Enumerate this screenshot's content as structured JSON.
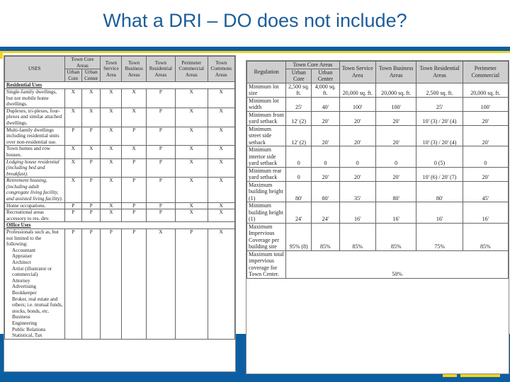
{
  "title": "What a DRI – DO does not include?",
  "uses_table": {
    "headers": {
      "uses": "USES",
      "town_core": "Town Core Areas",
      "urban_core": "Urban Core",
      "urban_center": "Urban Center",
      "town_service": "Town Service Area",
      "town_business": "Town Business Areas",
      "town_residential": "Town Residential Areas",
      "perimeter_commercial": "Perimeter Commercial Areas",
      "town_commons": "Town Commons Areas"
    },
    "section_residential": "Residential Uses",
    "residential_rows": [
      {
        "use": "Single-family dwellings, but not mobile home dwellings.",
        "v": [
          "X",
          "X",
          "X",
          "X",
          "P",
          "X",
          "X"
        ]
      },
      {
        "use": "Duplexes, tri-plexes, four-plexes and similar attached dwellings.",
        "v": [
          "X",
          "X",
          "X",
          "X",
          "P",
          "X",
          "X"
        ]
      },
      {
        "use": "Multi-family dwellings including residential units over non-residential use.",
        "v": [
          "P",
          "P",
          "X",
          "P",
          "P",
          "X",
          "X"
        ]
      },
      {
        "use": "Town homes and row houses.",
        "v": [
          "X",
          "X",
          "X",
          "X",
          "P",
          "X",
          "X"
        ]
      },
      {
        "use": "Lodging house residential (including bed and breakfast).",
        "v": [
          "X",
          "P",
          "X",
          "P",
          "P",
          "X",
          "X"
        ]
      },
      {
        "use": "Retirement housing, (including adult congregate living facility, and assisted living facility).",
        "v": [
          "X",
          "P",
          "X",
          "P",
          "P",
          "X",
          "X"
        ]
      },
      {
        "use": "Home occupations.",
        "v": [
          "P",
          "P",
          "X",
          "P",
          "P",
          "X",
          "X"
        ]
      },
      {
        "use": "Recreational areas accessory to res. dev.",
        "v": [
          "P",
          "P",
          "X",
          "P",
          "P",
          "X",
          "X"
        ]
      }
    ],
    "section_office": "Office Uses",
    "office_rows": [
      {
        "use": "Professionals such as, but not limited to the following:",
        "items": [
          "Accountant",
          "Appraiser",
          "Architect",
          "Artist (illustrator or commercial)",
          "Attorney",
          "Advertising",
          "Bookkeeper",
          "Broker, real estate and others; i.e. mutual funds, stocks, bonds, etc.",
          "Business",
          "Engineering",
          "Public Relations",
          "Statistical, Tax"
        ],
        "v": [
          "P",
          "P",
          "P",
          "P",
          "X",
          "P",
          "X"
        ]
      }
    ]
  },
  "regulation_table": {
    "headers": {
      "regulation": "Regulation",
      "town_core": "Town Core Areas",
      "urban_core": "Urban Core",
      "urban_center": "Urban Center",
      "town_service": "Town Service Area",
      "town_business": "Town Business Areas",
      "town_residential": "Town Residential Areas",
      "perimeter_commercial": "Perimeter Commercial"
    },
    "rows": [
      {
        "label": "Minimum lot size",
        "v": [
          "2,500 sq. ft.",
          "4,000 sq. ft.",
          "20,000 sq. ft.",
          "20,000 sq. ft.",
          "2,500 sq. ft.",
          "20,000 sq. ft."
        ]
      },
      {
        "label": "Minimum lot width",
        "v": [
          "25'",
          "40'",
          "100'",
          "100'",
          "25'",
          "100'"
        ]
      },
      {
        "label": "Minimum front yard setback",
        "v": [
          "12' (2)",
          "20'",
          "20'",
          "20'",
          "10' (3) / 20' (4)",
          "20'"
        ]
      },
      {
        "label": "Minimum street side setback",
        "v": [
          "12' (2)",
          "20'",
          "20'",
          "20'",
          "10' (3) / 20' (4)",
          "20'"
        ]
      },
      {
        "label": "Minimum interior side yard setback",
        "v": [
          "0",
          "0",
          "0",
          "0",
          "0 (5)",
          "0"
        ]
      },
      {
        "label": "Minimum rear yard setback",
        "v": [
          "0",
          "20'",
          "20'",
          "20'",
          "10' (6) / 20' (7)",
          "20'"
        ]
      },
      {
        "label": "Maximum building height (1)",
        "v": [
          "80'",
          "80'",
          "35'",
          "80'",
          "80'",
          "45'"
        ]
      },
      {
        "label": "Minimum building height (1)",
        "v": [
          "24'",
          "24'",
          "16'",
          "16'",
          "16'",
          "16'"
        ]
      },
      {
        "label": "Maximum Impervious Coverage per building site",
        "v": [
          "95% (8)",
          "85%",
          "85%",
          "85%",
          "75%",
          "85%"
        ]
      }
    ],
    "total_row": {
      "label": "Maximum total impervious coverage for Town Center.",
      "value": "50%"
    }
  }
}
